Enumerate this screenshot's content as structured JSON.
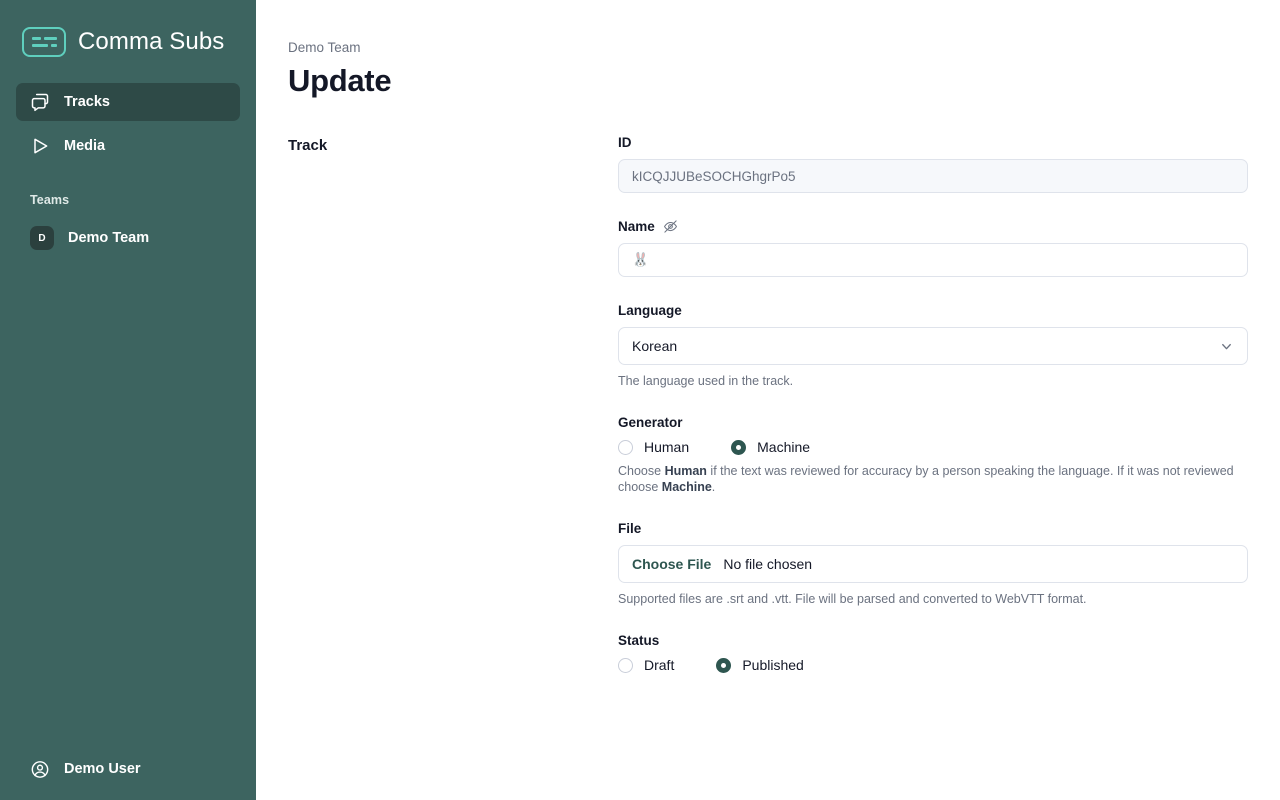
{
  "sidebar": {
    "brand": {
      "title": "Comma Subs",
      "logo_icon": "subtitles-icon"
    },
    "nav": [
      {
        "label": "Tracks",
        "icon": "speech-bubbles-icon",
        "active": true
      },
      {
        "label": "Media",
        "icon": "play-triangle-icon",
        "active": false
      }
    ],
    "teams_section_label": "Teams",
    "teams": [
      {
        "initial": "D",
        "name": "Demo Team"
      }
    ],
    "user": {
      "name": "Demo User",
      "icon": "user-circle-icon"
    },
    "colors": {
      "background": "#3d6460",
      "active_item": "#2e4a47",
      "logo_accent": "#5fcfbe",
      "avatar_background": "#2b403e"
    }
  },
  "main": {
    "breadcrumb": "Demo Team",
    "page_title": "Update",
    "section_label": "Track",
    "fields": {
      "id": {
        "label": "ID",
        "value": "kICQJJUBeSOCHGhgrPo5",
        "readonly": true
      },
      "name": {
        "label": "Name",
        "icon": "eye-off-icon",
        "value": "🐰"
      },
      "language": {
        "label": "Language",
        "selected": "Korean",
        "help": "The language used in the track.",
        "chevron_icon": "chevron-down-icon"
      },
      "generator": {
        "label": "Generator",
        "options": [
          {
            "label": "Human",
            "selected": false
          },
          {
            "label": "Machine",
            "selected": true
          }
        ],
        "help_parts": {
          "a": "Choose ",
          "b": "Human",
          "c": " if the text was reviewed for accuracy by a person speaking the language. If it was not reviewed choose ",
          "d": "Machine",
          "e": "."
        }
      },
      "file": {
        "label": "File",
        "button_label": "Choose File",
        "status": "No file chosen",
        "help": "Supported files are .srt and .vtt. File will be parsed and converted to WebVTT format."
      },
      "status": {
        "label": "Status",
        "options": [
          {
            "label": "Draft",
            "selected": false
          },
          {
            "label": "Published",
            "selected": true
          }
        ]
      }
    }
  },
  "theme": {
    "accent": "#2e5650",
    "text": "#141827",
    "muted": "#6b7280",
    "border": "#dfe3eb"
  }
}
